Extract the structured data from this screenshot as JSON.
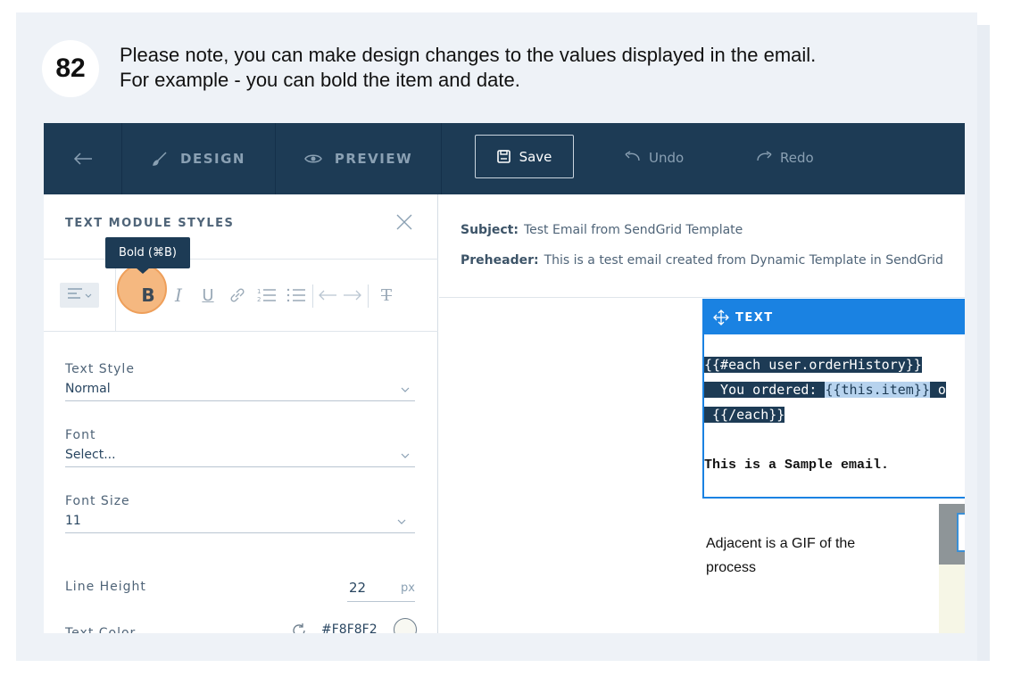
{
  "step": {
    "number": "82",
    "line1": "Please note, you can make design changes to the values displayed in the email.",
    "line2": "For example - you can bold the item and date."
  },
  "topbar": {
    "back_icon": "arrow-left-icon",
    "design_label": "DESIGN",
    "preview_label": "PREVIEW",
    "save_label": "Save",
    "undo_label": "Undo",
    "redo_label": "Redo"
  },
  "left_panel": {
    "title": "TEXT MODULE STYLES",
    "tooltip": "Bold (⌘B)",
    "toolbar": {
      "bold": "B",
      "italic": "I",
      "underline": "U",
      "clear_format": "T"
    },
    "fields": {
      "text_style": {
        "label": "Text Style",
        "value": "Normal"
      },
      "font": {
        "label": "Font",
        "value": "Select..."
      },
      "font_size": {
        "label": "Font Size",
        "value": "11"
      },
      "line_height": {
        "label": "Line Height",
        "value": "22",
        "unit": "px"
      },
      "text_color": {
        "label": "Text Color",
        "value": "#F8F8F2"
      }
    }
  },
  "preview": {
    "subject_label": "Subject:",
    "subject_value": "Test Email from SendGrid Template",
    "preheader_label": "Preheader:",
    "preheader_value": "This is a test email created from Dynamic Template in SendGrid",
    "module_label": "TEXT",
    "code": {
      "line1": "{{#each user.orderHistory}}",
      "line2_prefix": "  You ordered: ",
      "line2_selected": "{{this.item}}",
      "line2_suffix": " o",
      "line3": " {{/each}}"
    },
    "sample": "This is a Sample email.",
    "note_line1": "Adjacent is a GIF of the",
    "note_line2": "process"
  },
  "colors": {
    "topbar": "#1d3b55",
    "accent": "#1a82e2",
    "highlight": "#f5b57a"
  }
}
